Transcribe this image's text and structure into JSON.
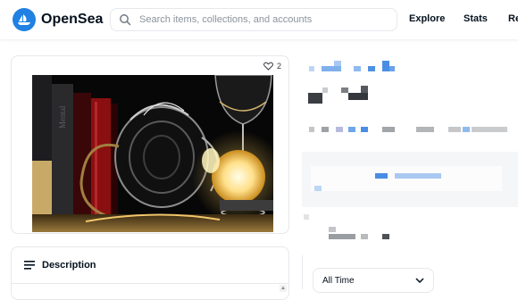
{
  "app": {
    "name": "OpenSea",
    "brand_color": "#2081e2"
  },
  "search": {
    "placeholder": "Search items, collections, and accounts",
    "icon": "search-icon"
  },
  "nav": {
    "items": [
      {
        "label": "Explore"
      },
      {
        "label": "Stats"
      },
      {
        "label": "Re"
      }
    ]
  },
  "item": {
    "like_count": "2"
  },
  "description": {
    "title": "Description"
  },
  "filter": {
    "selected": "All Time"
  }
}
